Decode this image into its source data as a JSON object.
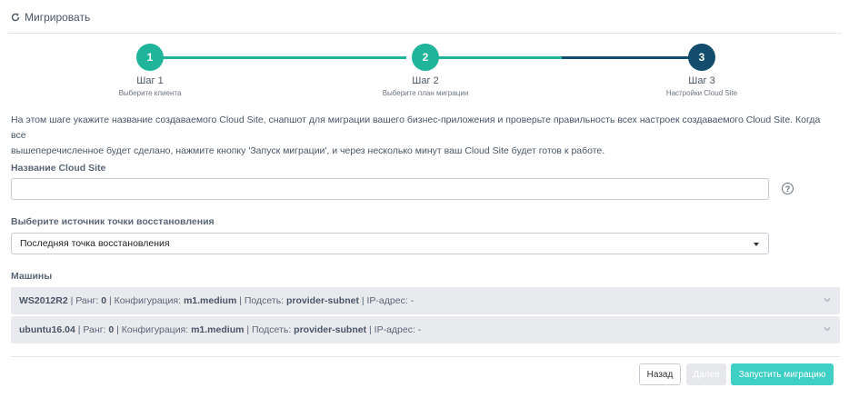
{
  "header": {
    "title": "Мигрировать",
    "icon": "refresh-icon"
  },
  "steps": [
    {
      "number": "1",
      "title": "Шаг 1",
      "subtitle": "Выберите клиента"
    },
    {
      "number": "2",
      "title": "Шаг 2",
      "subtitle": "Выберите план миграции"
    },
    {
      "number": "3",
      "title": "Шаг 3",
      "subtitle": "Настройки Cloud Site"
    }
  ],
  "intro_line1": "На этом шаге укажите название создаваемого Cloud Site, снапшот для миграции вашего бизнес-приложения и проверьте правильность всех настроек создаваемого Cloud Site. Когда все",
  "intro_line2": "вышеперечисленное будет сделано, нажмите кнопку 'Запуск миграции', и через несколько минут ваш Cloud Site будет готов к работе.",
  "form": {
    "name_label": "Название Cloud Site",
    "name_value": "",
    "help_glyph": "?",
    "source_label": "Выберите источник точки восстановления",
    "source_value": "Последняя точка восстановления",
    "machines_label": "Машины"
  },
  "machines": [
    {
      "name": "WS2012R2",
      "rank_label": " | Ранг: ",
      "rank": "0",
      "config_label": " | Конфигурация: ",
      "config": "m1.medium",
      "subnet_label": " | Подсеть: ",
      "subnet": "provider-subnet",
      "ip_label": " | IP-адрес: -"
    },
    {
      "name": "ubuntu16.04",
      "rank_label": " | Ранг: ",
      "rank": "0",
      "config_label": " | Конфигурация: ",
      "config": "m1.medium",
      "subnet_label": " | Подсеть: ",
      "subnet": "provider-subnet",
      "ip_label": " | IP-адрес: -"
    }
  ],
  "buttons": {
    "back": "Назад",
    "next": "Далее",
    "run": "Запустить миграцию"
  },
  "colors": {
    "teal": "#20b49b",
    "navy": "#124d6e",
    "run_button": "#40cfc4"
  }
}
